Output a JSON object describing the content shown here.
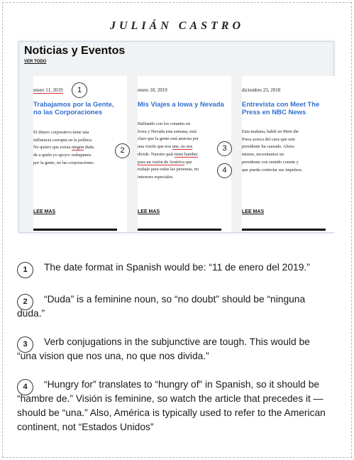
{
  "header": {
    "title": "JULIÁN CASTRO"
  },
  "site": {
    "heading": "Noticias y Eventos",
    "see_all": "VER TODO"
  },
  "cards": [
    {
      "date": "enero 11, 2019",
      "title": "Trabajamos por la Gente, no las Corporaciones",
      "body_lines": [
        "El dinero corporativo tiene una",
        "influencia corrupta en la política.",
        "No quiero que exista ningún duda",
        "de a quién yo apoyo: trabajamos",
        "por la gente, no las corporaciones."
      ],
      "read_more": "LEE MAS"
    },
    {
      "date": "enero 10, 2019",
      "title": "Mis Viajes a Iowa y Nevada",
      "body_lines": [
        "Hablando con los votantes en",
        "Iowa y Nevada esta semana, está",
        "claro que la gente está ansiosa por",
        "una visión que nos une, no nos",
        "divide. Nuestro país tiene hambre",
        "para un visión de América que",
        "trabaje para todas las personas, no",
        "intereses especiales."
      ],
      "read_more": "LEE MAS"
    },
    {
      "date": "diciembre 23, 2018",
      "title": "Entrevista con Meet The Press en NBC News",
      "body_lines": [
        "Esta mañana, hablé en Meet the",
        "Press acerca del caos que este",
        "presidente ha causado. Ahora",
        "mismo, necesitamos un",
        "presidente con sentido común y",
        "que pueda controlar sus impulsos."
      ],
      "read_more": "LEE MAS"
    }
  ],
  "markers": [
    "1",
    "2",
    "3",
    "4"
  ],
  "notes": [
    {
      "num": "1",
      "text": "The date format in Spanish would be: “11 de enero del 2019.”"
    },
    {
      "num": "2",
      "text": "“Duda” is a feminine noun, so “no doubt” should be “ninguna duda.”"
    },
    {
      "num": "3",
      "text": "Verb conjugations in the subjunctive are tough. This would be “una vision que nos una, no que nos divida.”"
    },
    {
      "num": "4",
      "text": "“Hungry for” translates to “hungry of” in Spanish, so it should be “hambre de.” Visión is feminine, so watch the article that precedes it — should be “una.” Also, América is typically used to refer to the American continent, not “Estados Unidos”"
    }
  ],
  "colors": {
    "title_blue": "#2f6fd0",
    "underline_red": "#d0343c"
  }
}
